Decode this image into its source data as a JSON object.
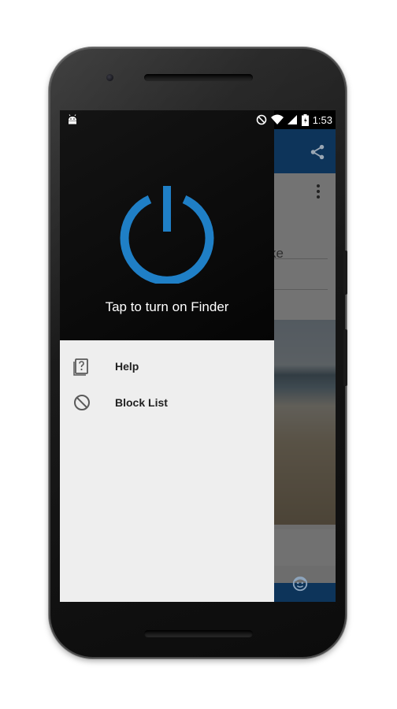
{
  "status_bar": {
    "time": "1:53"
  },
  "drawer": {
    "header": {
      "power_label": "Tap to turn on Finder"
    },
    "menu": [
      {
        "label": "Help",
        "icon": "help-icon"
      },
      {
        "label": "Block List",
        "icon": "block-icon"
      }
    ]
  },
  "background_app": {
    "partial_text": "ke"
  },
  "colors": {
    "accent": "#1e74c8",
    "power_ring": "#1f7fc6",
    "drawer_bg": "#eeeeee",
    "header_bg": "#000000"
  }
}
